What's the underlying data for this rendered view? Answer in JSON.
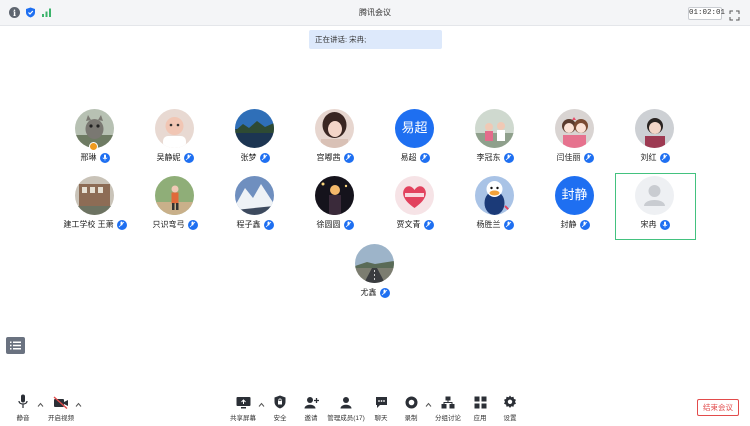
{
  "window": {
    "title": "腾讯会议",
    "timer": "01:02:01",
    "icons": [
      "info-icon",
      "shield-icon",
      "signal-icon",
      "fullscreen-icon"
    ]
  },
  "speaking": {
    "label": "正在讲话: 宋冉;"
  },
  "participants": [
    {
      "name": "邢琳",
      "avatar": "photo-cat",
      "mic": "on"
    },
    {
      "name": "吴静妮",
      "avatar": "photo-baby",
      "mic": "muted"
    },
    {
      "name": "张梦",
      "avatar": "photo-lake",
      "mic": "muted"
    },
    {
      "name": "宫嘟茜",
      "avatar": "photo-girl",
      "mic": "muted"
    },
    {
      "name": "易超",
      "avatar_text": "易超",
      "mic": "muted"
    },
    {
      "name": "李冠东",
      "avatar": "photo-kids",
      "mic": "muted"
    },
    {
      "name": "闫佳丽",
      "avatar": "photo-cartoon",
      "mic": "muted"
    },
    {
      "name": "刘红",
      "avatar": "photo-child",
      "mic": "muted"
    },
    {
      "name": "建工学校 王萧",
      "avatar": "photo-building",
      "mic": "muted"
    },
    {
      "name": "只识弯弓",
      "avatar": "photo-runner",
      "mic": "muted"
    },
    {
      "name": "程子鑫",
      "avatar": "photo-mountain",
      "mic": "muted"
    },
    {
      "name": "徐圆圆",
      "avatar": "photo-night",
      "mic": "muted"
    },
    {
      "name": "贾文青",
      "avatar": "photo-heart",
      "mic": "muted"
    },
    {
      "name": "杨胜兰",
      "avatar": "photo-duck",
      "mic": "muted"
    },
    {
      "name": "封静",
      "avatar_text": "封静",
      "mic": "muted"
    },
    {
      "name": "宋冉",
      "avatar": "placeholder-person",
      "mic": "on",
      "selected": true
    },
    {
      "name": "尤鑫",
      "avatar": "photo-road",
      "mic": "muted"
    }
  ],
  "toolbar": {
    "mute": "静音",
    "video": "开启视频",
    "share": "共享屏幕",
    "security": "安全",
    "invite": "邀请",
    "members": "管理成员(17)",
    "chat": "聊天",
    "record": "录制",
    "breakout": "分组讨论",
    "apps": "应用",
    "settings": "设置",
    "end": "结束会议"
  },
  "colors": {
    "accent": "#1e6ff1",
    "selected_border": "#43c27f",
    "end_button": "#e24b4b",
    "speaking_bg": "#dde9fb"
  }
}
